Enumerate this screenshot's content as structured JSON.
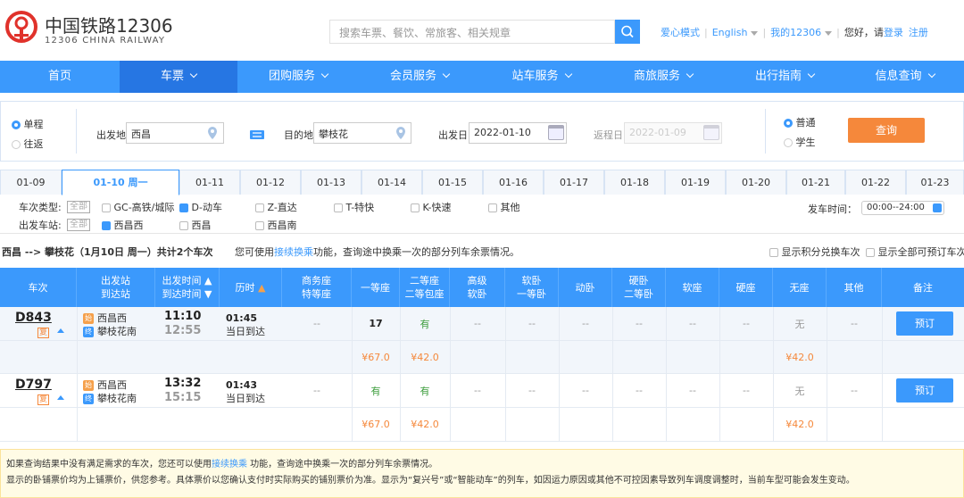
{
  "logo": {
    "cn": "中国铁路12306",
    "en": "12306 CHINA RAILWAY"
  },
  "search": {
    "placeholder": "搜索车票、餐饮、常旅客、相关规章"
  },
  "toplinks": {
    "care": "爱心模式",
    "english": "English",
    "my": "我的12306",
    "greeting": "您好，请",
    "login": "登录",
    "register": "注册"
  },
  "nav": [
    {
      "label": "首页"
    },
    {
      "label": "车票"
    },
    {
      "label": "团购服务"
    },
    {
      "label": "会员服务"
    },
    {
      "label": "站车服务"
    },
    {
      "label": "商旅服务"
    },
    {
      "label": "出行指南"
    },
    {
      "label": "信息查询"
    }
  ],
  "query": {
    "one_way": "单程",
    "round_trip": "往返",
    "from_label": "出发地",
    "from_value": "西昌",
    "to_label": "目的地",
    "to_value": "攀枝花",
    "date_label": "出发日",
    "date_value": "2022-01-10",
    "return_label": "返程日",
    "return_value": "2022-01-09",
    "normal": "普通",
    "student": "学生",
    "search_btn": "查询"
  },
  "dates": [
    "01-09",
    "01-10 周一",
    "01-11",
    "01-12",
    "01-13",
    "01-14",
    "01-15",
    "01-16",
    "01-17",
    "01-18",
    "01-19",
    "01-20",
    "01-21",
    "01-22",
    "01-23"
  ],
  "filters": {
    "type_label": "车次类型:",
    "all": "全部",
    "gc": "GC-高铁/城际",
    "d": "D-动车",
    "z": "Z-直达",
    "t": "T-特快",
    "k": "K-快速",
    "other": "其他",
    "station_label": "出发车站:",
    "st1": "西昌西",
    "st2": "西昌",
    "st3": "西昌南",
    "time_label": "发车时间：",
    "time_value": "00:00--24:00"
  },
  "summary": {
    "route": "西昌 --> 攀枝花（1月10日 周一）共计2个车次",
    "tip_pre": "您可使用",
    "tip_link": "接续换乘",
    "tip_post": "功能，查询途中换乘一次的部分列车余票情况。",
    "opt1": "显示积分兑换车次",
    "opt2": "显示全部可预订车次"
  },
  "headers": {
    "train": "车次",
    "station1": "出发站",
    "station2": "到达站",
    "time1": "出发时间",
    "time2": "到达时间",
    "duration": "历时",
    "business1": "商务座",
    "business2": "特等座",
    "first": "一等座",
    "second1": "二等座",
    "second2": "二等包座",
    "hsoft1": "高级",
    "hsoft2": "软卧",
    "soft1": "软卧",
    "soft2": "一等卧",
    "dongwo": "动卧",
    "hard1": "硬卧",
    "hard2": "二等卧",
    "softseat": "软座",
    "hardseat": "硬座",
    "noseat": "无座",
    "other": "其他",
    "remark": "备注"
  },
  "trains": [
    {
      "no": "D843",
      "fu": "复",
      "from": "西昌西",
      "to": "攀枝花南",
      "dep": "11:10",
      "arr": "12:55",
      "dur": "01:45",
      "dur_note": "当日到达",
      "business": "--",
      "first": "17",
      "second": "有",
      "hsoft": "--",
      "soft": "--",
      "dongwo": "--",
      "hard": "--",
      "softseat": "--",
      "hardseat": "--",
      "noseat": "无",
      "other": "--",
      "book": "预订",
      "price_first": "¥67.0",
      "price_second": "¥42.0",
      "price_noseat": "¥42.0"
    },
    {
      "no": "D797",
      "fu": "复",
      "from": "西昌西",
      "to": "攀枝花南",
      "dep": "13:32",
      "arr": "15:15",
      "dur": "01:43",
      "dur_note": "当日到达",
      "business": "--",
      "first": "有",
      "second": "有",
      "hsoft": "--",
      "soft": "--",
      "dongwo": "--",
      "hard": "--",
      "softseat": "--",
      "hardseat": "--",
      "noseat": "无",
      "other": "--",
      "book": "预订",
      "price_first": "¥67.0",
      "price_second": "¥42.0",
      "price_noseat": "¥42.0"
    }
  ],
  "notes": {
    "line1_pre": "如果查询结果中没有满足需求的车次，您还可以使用",
    "line1_link": "接续换乘",
    "line1_post": " 功能，查询途中换乘一次的部分列车余票情况。",
    "line2": "显示的卧铺票价均为上铺票价，供您参考。具体票价以您确认支付时实际购买的铺别票价为准。显示为“复兴号”或“智能动车”的列车，如因运力原因或其他不可控因素导致列车调度调整时，当前车型可能会发生变动。"
  }
}
